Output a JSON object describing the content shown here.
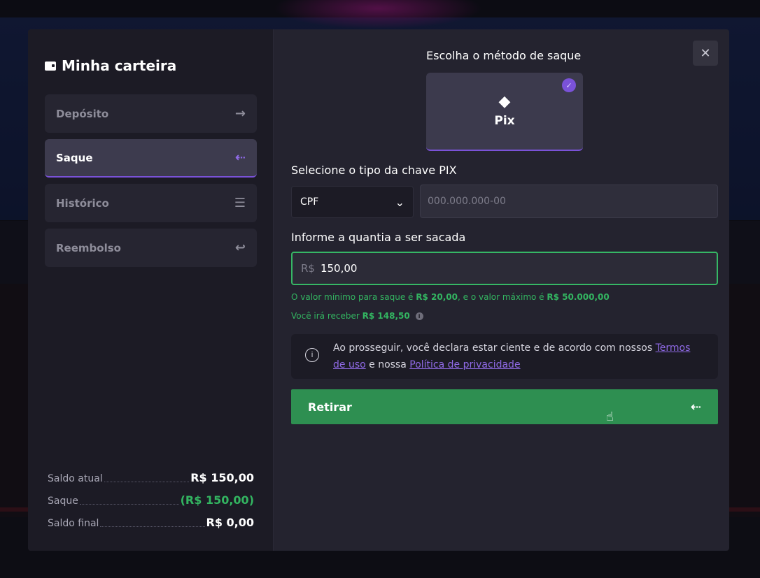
{
  "sidebar": {
    "title": "Minha carteira",
    "items": [
      {
        "label": "Depósito",
        "icon": "→"
      },
      {
        "label": "Saque",
        "icon": "⇠"
      },
      {
        "label": "Histórico",
        "icon": "☰"
      },
      {
        "label": "Reembolso",
        "icon": "↩"
      }
    ],
    "summary": [
      {
        "label": "Saldo atual",
        "value": "R$ 150,00"
      },
      {
        "label": "Saque",
        "value": "(R$ 150,00)"
      },
      {
        "label": "Saldo final",
        "value": "R$ 0,00"
      }
    ]
  },
  "main": {
    "close": "✕",
    "method_heading": "Escolha o método de saque",
    "method": {
      "name": "Pix",
      "check": "✓",
      "icon": "◆"
    },
    "key_type_label": "Selecione o tipo da chave PIX",
    "key_type_value": "CPF",
    "key_placeholder": "000.000.000-00",
    "amount_label": "Informe a quantia a ser sacada",
    "amount_currency": "R$",
    "amount_value": "150,00",
    "limits": {
      "pre": "O valor mínimo para saque é",
      "min": "R$ 20,00",
      "mid": ", e o valor máximo é",
      "max": "R$ 50.000,00"
    },
    "receive": {
      "pre": "Você irá receber",
      "value": "R$ 148,50"
    },
    "terms": {
      "pre": "Ao prosseguir, você declara estar ciente e de acordo com nossos",
      "link1": "Termos de uso",
      "mid": "e nossa",
      "link2": "Política de privacidade"
    },
    "submit_label": "Retirar"
  },
  "colors": {
    "accent": "#7a52d8",
    "success": "#33b561",
    "button": "#2e8f51"
  }
}
